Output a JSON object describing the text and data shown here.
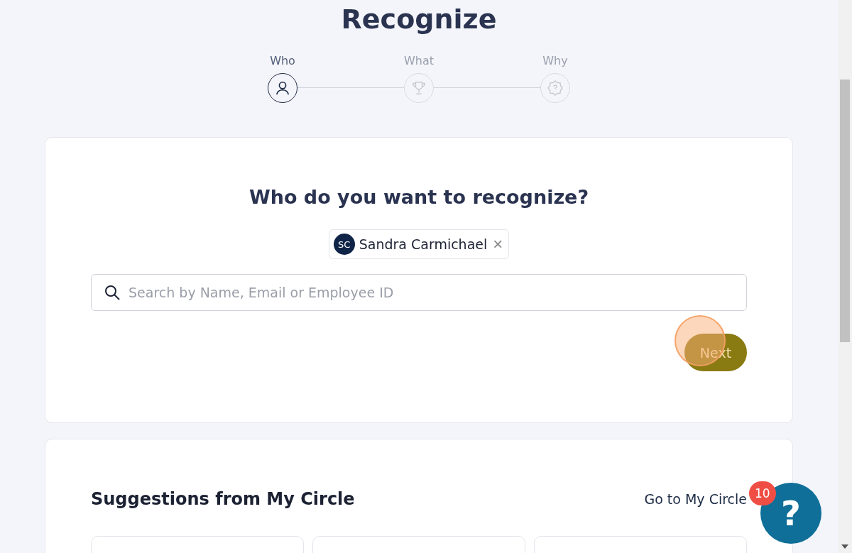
{
  "title": "Recognize",
  "steps": [
    {
      "label": "Who",
      "kind": "person",
      "selected": true
    },
    {
      "label": "What",
      "kind": "trophy",
      "selected": false
    },
    {
      "label": "Why",
      "kind": "badge",
      "selected": false
    }
  ],
  "who_card": {
    "heading": "Who do you want to recognize?",
    "chips": [
      {
        "initials": "SC",
        "name": "Sandra Carmichael",
        "remove": "×"
      }
    ],
    "search": {
      "placeholder": "Search by Name, Email or Employee ID"
    },
    "next_button": "Next"
  },
  "suggestions": {
    "heading": "Suggestions from My Circle",
    "link": "Go to My Circle",
    "cards": [
      {
        "kind": "empty"
      },
      {
        "kind": "empty"
      },
      {
        "kind": "empty"
      }
    ]
  },
  "help": {
    "symbol": "?",
    "badge": "10"
  }
}
